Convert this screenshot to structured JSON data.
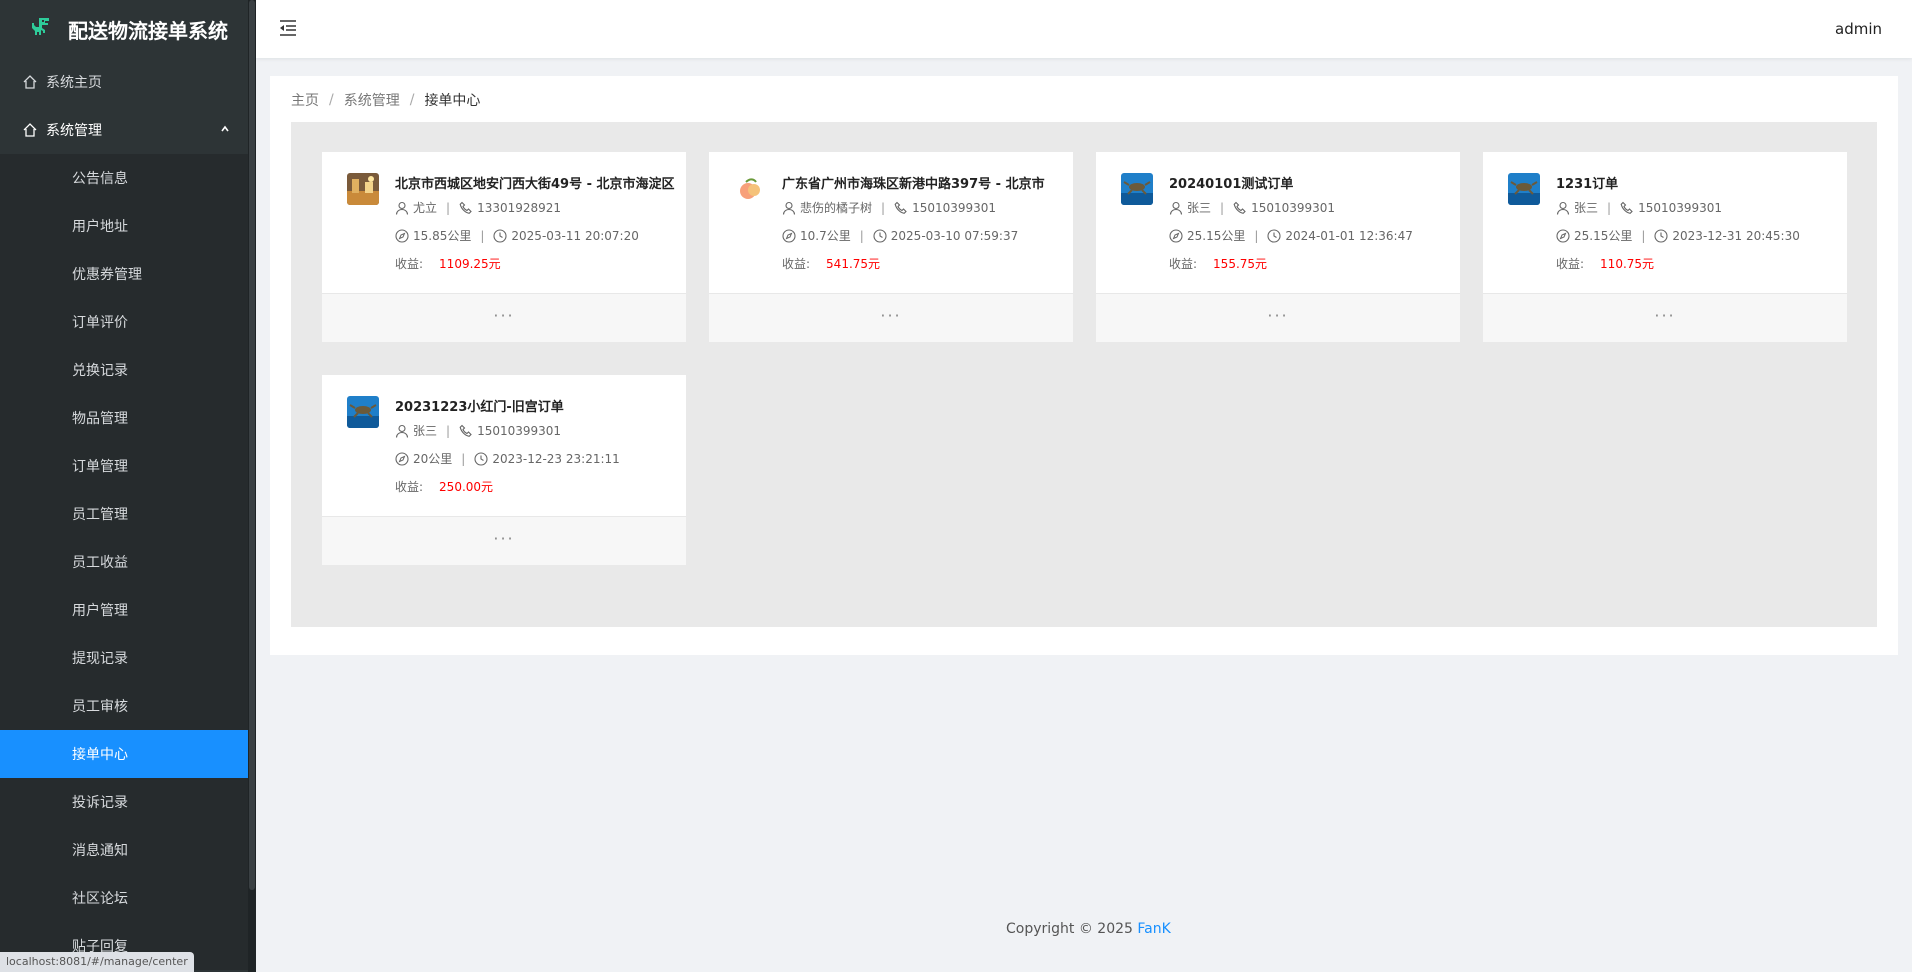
{
  "app": {
    "title": "配送物流接单系统",
    "user": "admin"
  },
  "sidebar": {
    "home": "系统主页",
    "group": "系统管理",
    "items": [
      {
        "label": "公告信息"
      },
      {
        "label": "用户地址"
      },
      {
        "label": "优惠券管理"
      },
      {
        "label": "订单评价"
      },
      {
        "label": "兑换记录"
      },
      {
        "label": "物品管理"
      },
      {
        "label": "订单管理"
      },
      {
        "label": "员工管理"
      },
      {
        "label": "员工收益"
      },
      {
        "label": "用户管理"
      },
      {
        "label": "提现记录"
      },
      {
        "label": "员工审核"
      },
      {
        "label": "接单中心",
        "active": true
      },
      {
        "label": "投诉记录"
      },
      {
        "label": "消息通知"
      },
      {
        "label": "社区论坛"
      },
      {
        "label": "贴子回复"
      }
    ]
  },
  "breadcrumb": {
    "home": "主页",
    "section": "系统管理",
    "current": "接单中心"
  },
  "income_label": "收益:",
  "more": "···",
  "orders": [
    {
      "title": "北京市西城区地安门西大街49号 - 北京市海淀区",
      "name": "尤立",
      "phone": "13301928921",
      "distance": "15.85公里",
      "time": "2025-03-11 20:07:20",
      "income": "1109.25元",
      "avatar": "city-photo"
    },
    {
      "title": "广东省广州市海珠区新港中路397号 - 北京市",
      "name": "悲伤的橘子树",
      "phone": "15010399301",
      "distance": "10.7公里",
      "time": "2025-03-10 07:59:37",
      "income": "541.75元",
      "avatar": "peach-illustration"
    },
    {
      "title": "20240101测试订单",
      "name": "张三",
      "phone": "15010399301",
      "distance": "25.15公里",
      "time": "2024-01-01 12:36:47",
      "income": "155.75元",
      "avatar": "sea-turtle"
    },
    {
      "title": "1231订单",
      "name": "张三",
      "phone": "15010399301",
      "distance": "25.15公里",
      "time": "2023-12-31 20:45:30",
      "income": "110.75元",
      "avatar": "sea-turtle"
    },
    {
      "title": "20231223小红门-旧宫订单",
      "name": "张三",
      "phone": "15010399301",
      "distance": "20公里",
      "time": "2023-12-23 23:21:11",
      "income": "250.00元",
      "avatar": "sea-turtle"
    }
  ],
  "footer": {
    "text": "Copyright © 2025",
    "author": "FanK"
  },
  "status_url": "localhost:8081/#/manage/center",
  "colors": {
    "sidebar": "#2d3436",
    "active": "#1890ff",
    "income": "#ff0000",
    "link": "#1890ff"
  }
}
